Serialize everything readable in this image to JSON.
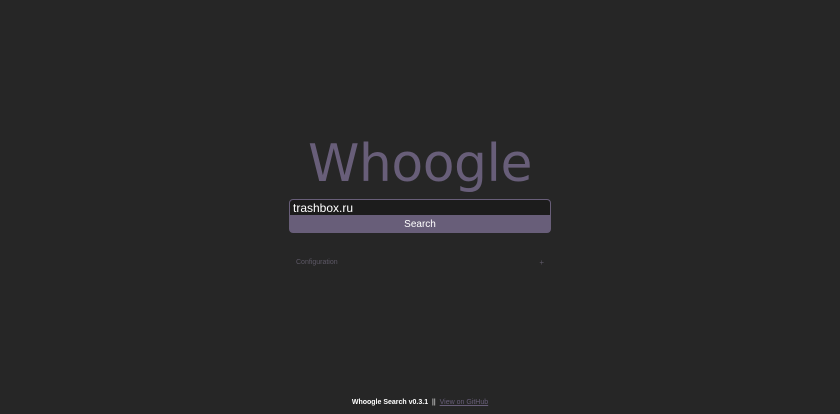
{
  "logo": {
    "text": "Whoogle"
  },
  "search": {
    "query": "trashbox.ru",
    "button_label": "Search"
  },
  "config": {
    "label": "Configuration",
    "toggle": "+"
  },
  "footer": {
    "brand": "Whoogle Search v0.3.1",
    "separator": "||",
    "link_text": "View on GitHub"
  },
  "colors": {
    "background": "#262626",
    "accent": "#685e79",
    "input_background": "#1c1c1c",
    "text": "#ffffff"
  }
}
